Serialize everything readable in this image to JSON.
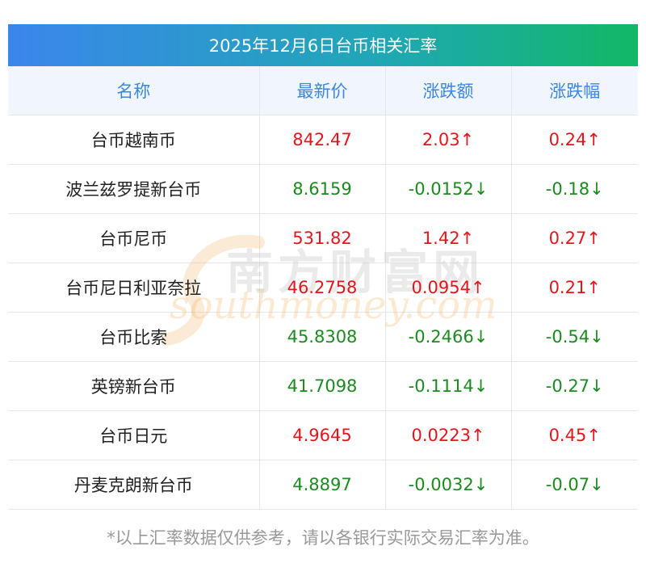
{
  "title": "2025年12月6日台币相关汇率",
  "columns": [
    "名称",
    "最新价",
    "涨跌额",
    "涨跌幅"
  ],
  "rows": [
    {
      "name": "台币越南币",
      "price": "842.47",
      "change": "2.03↑",
      "pct": "0.24↑",
      "dir": "up"
    },
    {
      "name": "波兰兹罗提新台币",
      "price": "8.6159",
      "change": "-0.0152↓",
      "pct": "-0.18↓",
      "dir": "down"
    },
    {
      "name": "台币尼币",
      "price": "531.82",
      "change": "1.42↑",
      "pct": "0.27↑",
      "dir": "up"
    },
    {
      "name": "台币尼日利亚奈拉",
      "price": "46.2758",
      "change": "0.0954↑",
      "pct": "0.21↑",
      "dir": "up"
    },
    {
      "name": "台币比索",
      "price": "45.8308",
      "change": "-0.2466↓",
      "pct": "-0.54↓",
      "dir": "down"
    },
    {
      "name": "英镑新台币",
      "price": "41.7098",
      "change": "-0.1114↓",
      "pct": "-0.27↓",
      "dir": "down"
    },
    {
      "name": "台币日元",
      "price": "4.9645",
      "change": "0.0223↑",
      "pct": "0.45↑",
      "dir": "up"
    },
    {
      "name": "丹麦克朗新台币",
      "price": "4.8897",
      "change": "-0.0032↓",
      "pct": "-0.07↓",
      "dir": "down"
    }
  ],
  "watermark": {
    "cn": "南方财富网",
    "en": "southmoney.com"
  },
  "footnote": "*以上汇率数据仅供参考，请以各银行实际交易汇率为准。",
  "colors": {
    "up": "#e8141b",
    "down": "#1b8a1f",
    "header_text": "#3a86e0",
    "title_gradient_start": "#3b86ec",
    "title_gradient_end": "#12b865"
  }
}
